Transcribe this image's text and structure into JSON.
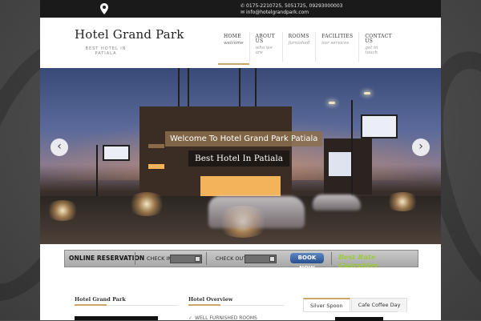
{
  "topbar": {
    "pin_icon": "map-pin-icon",
    "phone_icon": "phone-icon",
    "mail_icon": "mail-icon",
    "phones": "0175-2210725, 5051725, 09293000003",
    "email": "info@hotelgrandpark.com"
  },
  "brand": {
    "name": "Hotel Grand Park",
    "tagline_line1": "BEST HOTEL IN",
    "tagline_line2": "PATIALA"
  },
  "nav": {
    "items": [
      {
        "label": "HOME",
        "sub": "welcome",
        "active": true
      },
      {
        "label": "ABOUT US",
        "sub": "who we are",
        "active": false
      },
      {
        "label": "ROOMS",
        "sub": "furnished",
        "active": false
      },
      {
        "label": "FACILITIES",
        "sub": "our services",
        "active": false
      },
      {
        "label": "CONTACT US",
        "sub": "get in touch",
        "active": false
      }
    ],
    "accent_color": "#c9a76a"
  },
  "slider": {
    "caption_primary": "Welcome To Hotel Grand Park Patiala",
    "caption_secondary": "Best Hotel In Patiala",
    "prev_icon": "chevron-left-icon",
    "next_icon": "chevron-right-icon",
    "prev_glyph": "‹",
    "next_glyph": "›"
  },
  "reservation": {
    "title": "ONLINE RESERVATION",
    "check_in_label": "CHECK IN",
    "check_out_label": "CHECK OUT",
    "calendar_icon": "calendar-icon",
    "book_now_label": "BOOK NOW",
    "best_rate_label": "Best Rate Guarantee",
    "best_rate_color": "#9ccc2d",
    "book_button_color": "#3a62a6"
  },
  "content": {
    "col1_title": "Hotel Grand Park",
    "col2_title": "Hotel Overview",
    "overview_items": [
      "WELL FURNISHED ROOMS"
    ],
    "tabs": [
      {
        "label": "Silver Spoon",
        "active": true
      },
      {
        "label": "Cafe Coffee Day",
        "active": false
      }
    ]
  }
}
